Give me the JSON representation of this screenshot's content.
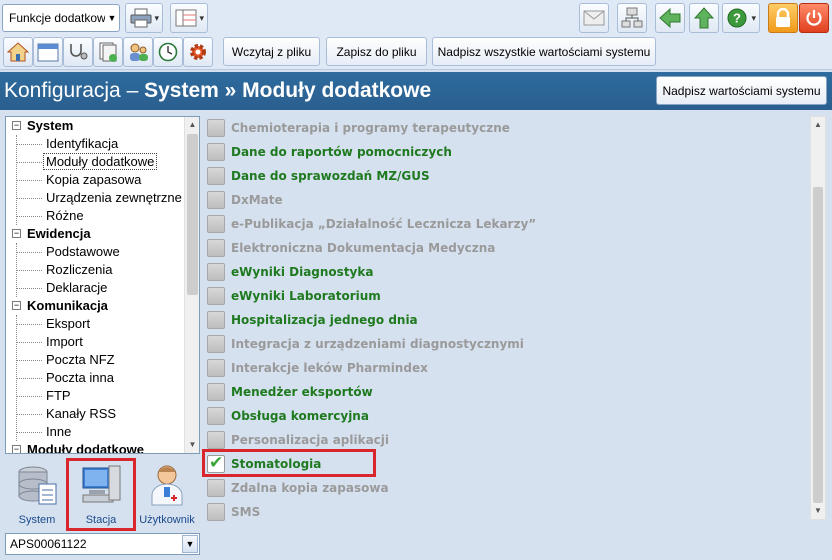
{
  "toolbar": {
    "functions_combo": "Funkcje dodatkowe",
    "load_button": "Wczytaj z pliku",
    "save_button": "Zapisz do pliku",
    "overwrite_all_button": "Nadpisz wszystkie wartościami systemu"
  },
  "header": {
    "title_prefix": "Konfiguracja – ",
    "title_bold": "System » Moduły dodatkowe",
    "overwrite_button": "Nadpisz wartościami systemu"
  },
  "tree": {
    "groups": [
      {
        "label": "System",
        "items": [
          "Identyfikacja",
          "Moduły dodatkowe",
          "Kopia zapasowa",
          "Urządzenia zewnętrzne",
          "Różne"
        ]
      },
      {
        "label": "Ewidencja",
        "items": [
          "Podstawowe",
          "Rozliczenia",
          "Deklaracje"
        ]
      },
      {
        "label": "Komunikacja",
        "items": [
          "Eksport",
          "Import",
          "Poczta NFZ",
          "Poczta inna",
          "FTP",
          "Kanały RSS",
          "Inne"
        ]
      },
      {
        "label": "Moduły dodatkowe",
        "items": []
      }
    ],
    "selected": "Moduły dodatkowe"
  },
  "nav": {
    "system": "System",
    "station": "Stacja",
    "user": "Użytkownik"
  },
  "station_select": "APS00061122",
  "modules": [
    {
      "label": "Chemioterapia i programy terapeutyczne",
      "enabled": false,
      "checked": false
    },
    {
      "label": "Dane do raportów pomocniczych",
      "enabled": true,
      "checked": false
    },
    {
      "label": "Dane do sprawozdań MZ/GUS",
      "enabled": true,
      "checked": false
    },
    {
      "label": "DxMate",
      "enabled": false,
      "checked": false
    },
    {
      "label": "e-Publikacja „Działalność Lecznicza Lekarzy”",
      "enabled": false,
      "checked": false
    },
    {
      "label": "Elektroniczna Dokumentacja Medyczna",
      "enabled": false,
      "checked": false
    },
    {
      "label": "eWyniki Diagnostyka",
      "enabled": true,
      "checked": false
    },
    {
      "label": "eWyniki Laboratorium",
      "enabled": true,
      "checked": false
    },
    {
      "label": "Hospitalizacja jednego dnia",
      "enabled": true,
      "checked": false
    },
    {
      "label": "Integracja z urządzeniami diagnostycznymi",
      "enabled": false,
      "checked": false
    },
    {
      "label": "Interakcje leków Pharmindex",
      "enabled": false,
      "checked": false
    },
    {
      "label": "Menedżer eksportów",
      "enabled": true,
      "checked": false
    },
    {
      "label": "Obsługa komercyjna",
      "enabled": true,
      "checked": false
    },
    {
      "label": "Personalizacja aplikacji",
      "enabled": false,
      "checked": false
    },
    {
      "label": "Stomatologia",
      "enabled": true,
      "checked": true
    },
    {
      "label": "Zdalna kopia zapasowa",
      "enabled": false,
      "checked": false
    },
    {
      "label": "SMS",
      "enabled": false,
      "checked": false
    }
  ],
  "colors": {
    "enabled_text": "#1f7a1f",
    "disabled_text": "#9a9a9a",
    "header_bg": "#2e6b9e",
    "highlight": "#d9262c"
  }
}
